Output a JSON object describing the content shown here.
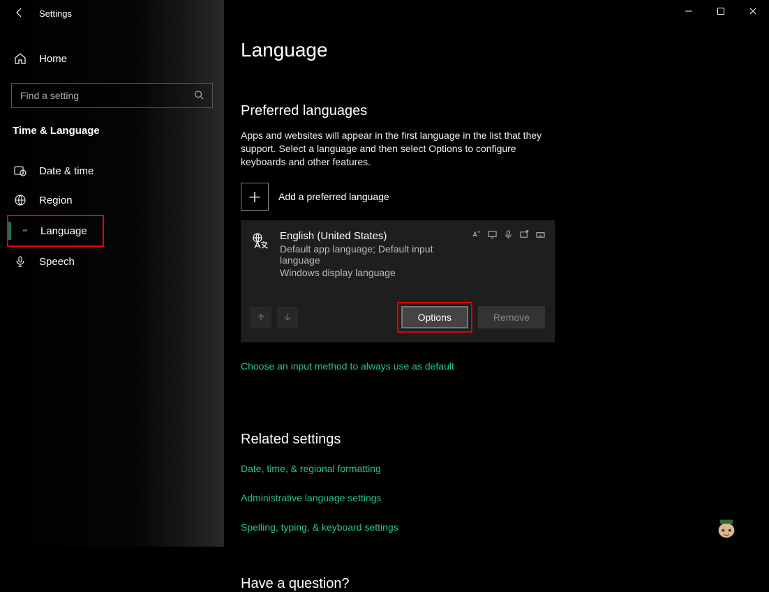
{
  "app_title": "Settings",
  "search": {
    "placeholder": "Find a setting"
  },
  "sidebar": {
    "home": "Home",
    "heading": "Time & Language",
    "items": [
      {
        "label": "Date & time"
      },
      {
        "label": "Region"
      },
      {
        "label": "Language"
      },
      {
        "label": "Speech"
      }
    ]
  },
  "page": {
    "title": "Language",
    "section1": {
      "heading": "Preferred languages",
      "description": "Apps and websites will appear in the first language in the list that they support. Select a language and then select Options to configure keyboards and other features.",
      "add_label": "Add a preferred language",
      "lang": {
        "name": "English (United States)",
        "sub1": "Default app language; Default input language",
        "sub2": "Windows display language"
      },
      "options_btn": "Options",
      "remove_btn": "Remove",
      "input_link": "Choose an input method to always use as default"
    },
    "section2": {
      "heading": "Related settings",
      "links": [
        "Date, time, & regional formatting",
        "Administrative language settings",
        "Spelling, typing, & keyboard settings"
      ]
    },
    "question": "Have a question?"
  }
}
